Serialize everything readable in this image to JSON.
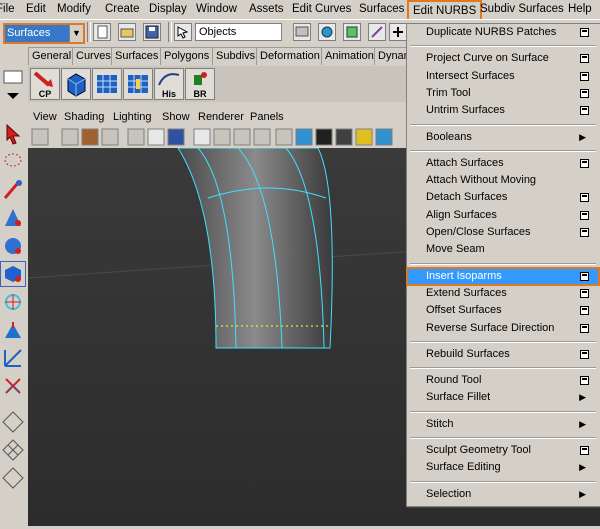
{
  "menubar": {
    "items": [
      "File",
      "Edit",
      "Modify",
      "Create",
      "Display",
      "Window",
      "Assets",
      "Edit Curves",
      "Surfaces",
      "Edit NURBS",
      "Subdiv Surfaces",
      "Help"
    ],
    "active": "Edit NURBS"
  },
  "statusline": {
    "mode": "Surfaces",
    "objects_value": "Objects"
  },
  "shelf": {
    "tabs": [
      "General",
      "Curves",
      "Surfaces",
      "Polygons",
      "Subdivs",
      "Deformation",
      "Animation",
      "Dynam"
    ],
    "icons": [
      {
        "name": "cp-icon",
        "label": "CP"
      },
      {
        "name": "cube-icon",
        "label": ""
      },
      {
        "name": "grid-icon",
        "label": ""
      },
      {
        "name": "grid2-icon",
        "label": ""
      },
      {
        "name": "his-icon",
        "label": "His"
      },
      {
        "name": "br-icon",
        "label": "BR"
      }
    ]
  },
  "panel_menu": [
    "View",
    "Shading",
    "Lighting",
    "Show",
    "Renderer",
    "Panels"
  ],
  "dropdown": {
    "items": [
      {
        "label": "Duplicate NURBS Patches",
        "kind": "opt"
      },
      {
        "kind": "sep"
      },
      {
        "label": "Project Curve on Surface",
        "kind": "opt"
      },
      {
        "label": "Intersect Surfaces",
        "kind": "opt"
      },
      {
        "label": "Trim Tool",
        "kind": "opt"
      },
      {
        "label": "Untrim Surfaces",
        "kind": "opt"
      },
      {
        "kind": "sep"
      },
      {
        "label": "Booleans",
        "kind": "sub"
      },
      {
        "kind": "sep"
      },
      {
        "label": "Attach Surfaces",
        "kind": "opt"
      },
      {
        "label": "Attach Without Moving",
        "kind": "none"
      },
      {
        "label": "Detach Surfaces",
        "kind": "opt"
      },
      {
        "label": "Align Surfaces",
        "kind": "opt"
      },
      {
        "label": "Open/Close Surfaces",
        "kind": "opt"
      },
      {
        "label": "Move Seam",
        "kind": "none"
      },
      {
        "kind": "sep"
      },
      {
        "label": "Insert Isoparms",
        "kind": "opt",
        "highlighted": true
      },
      {
        "label": "Extend Surfaces",
        "kind": "opt"
      },
      {
        "label": "Offset Surfaces",
        "kind": "opt"
      },
      {
        "label": "Reverse Surface Direction",
        "kind": "opt"
      },
      {
        "kind": "sep"
      },
      {
        "label": "Rebuild Surfaces",
        "kind": "opt"
      },
      {
        "kind": "sep"
      },
      {
        "label": "Round Tool",
        "kind": "opt"
      },
      {
        "label": "Surface Fillet",
        "kind": "sub"
      },
      {
        "kind": "sep"
      },
      {
        "label": "Stitch",
        "kind": "sub"
      },
      {
        "kind": "sep"
      },
      {
        "label": "Sculpt Geometry Tool",
        "kind": "opt"
      },
      {
        "label": "Surface Editing",
        "kind": "sub"
      },
      {
        "kind": "sep"
      },
      {
        "label": "Selection",
        "kind": "sub"
      }
    ]
  },
  "colors": {
    "highlight": "#3399ff",
    "focus_outline": "#e07820",
    "wireframe": "#40e0ff"
  }
}
